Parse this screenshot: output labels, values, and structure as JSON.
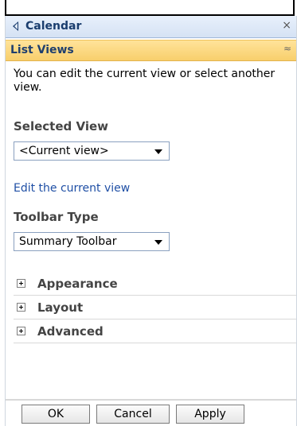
{
  "panel": {
    "title": "Calendar",
    "close_glyph": "×",
    "section_title": "List Views",
    "section_chevron": "≈",
    "description": "You can edit the current view or select another view.",
    "selected_view": {
      "heading": "Selected View",
      "value": "<Current view>",
      "link": "Edit the current view"
    },
    "toolbar_type": {
      "heading": "Toolbar Type",
      "value": "Summary Toolbar"
    },
    "sections": [
      {
        "label": "Appearance"
      },
      {
        "label": "Layout"
      },
      {
        "label": "Advanced"
      }
    ],
    "buttons": {
      "ok": "OK",
      "cancel": "Cancel",
      "apply": "Apply"
    }
  }
}
